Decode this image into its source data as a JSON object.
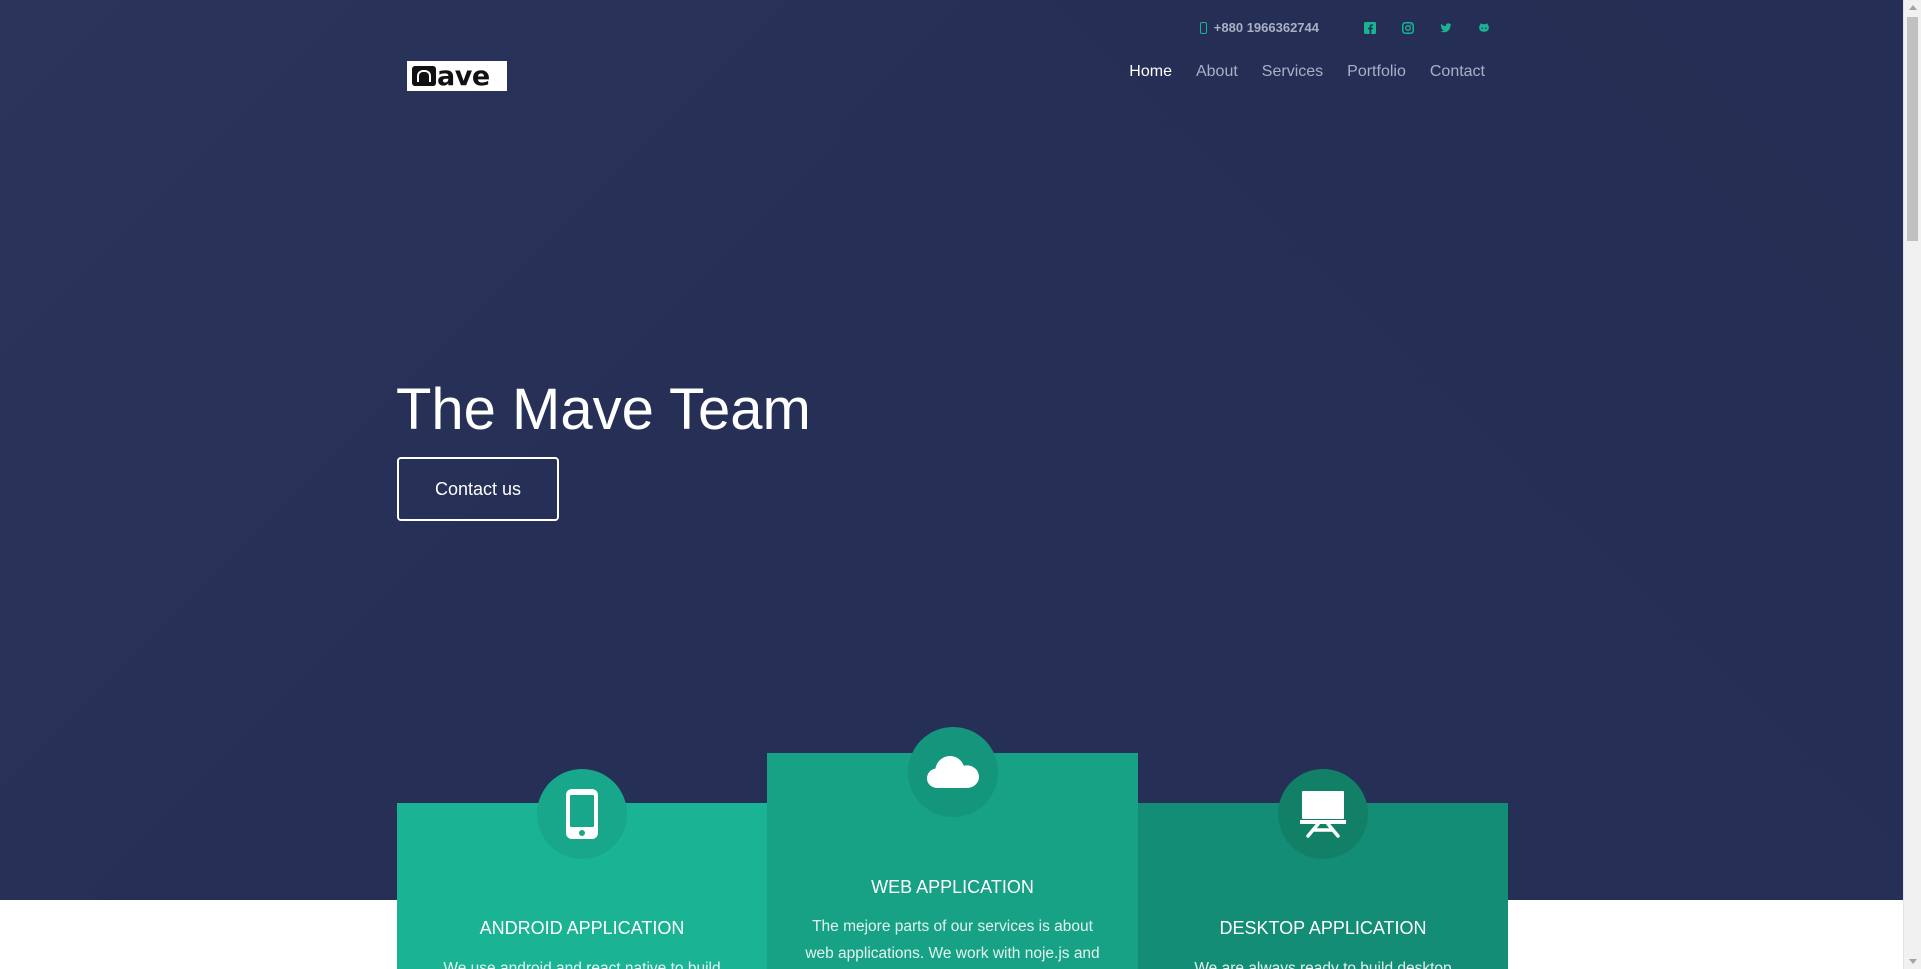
{
  "colors": {
    "hero_bg": "#263057",
    "accent": "#1ab394",
    "nav_muted": "#a9b0c6",
    "card_android": "#1ab394",
    "card_web": "#17a185",
    "card_desktop": "#138d75"
  },
  "topbar": {
    "phone_icon": "mobile-phone-icon",
    "phone": "+880 1966362744",
    "social_icons": [
      "facebook-icon",
      "instagram-icon",
      "twitter-icon",
      "github-icon"
    ]
  },
  "logo": {
    "text": "ave",
    "mark": "stylized-m-mark"
  },
  "nav": {
    "items": [
      "Home",
      "About",
      "Services",
      "Portfolio",
      "Contact"
    ],
    "active": "Home"
  },
  "hero": {
    "title": "The Mave Team",
    "button_label": "Contact us"
  },
  "services": [
    {
      "icon": "mobile-phone-icon",
      "title": "ANDROID APPLICATION",
      "text": "We use android and react native to build"
    },
    {
      "icon": "cloud-icon",
      "title": "WEB APPLICATION",
      "text": "The mejore parts of our services is about web applications. We work with noje.js and"
    },
    {
      "icon": "desktop-easel-icon",
      "title": "DESKTOP APPLICATION",
      "text": "We are always ready to build desktop"
    }
  ]
}
